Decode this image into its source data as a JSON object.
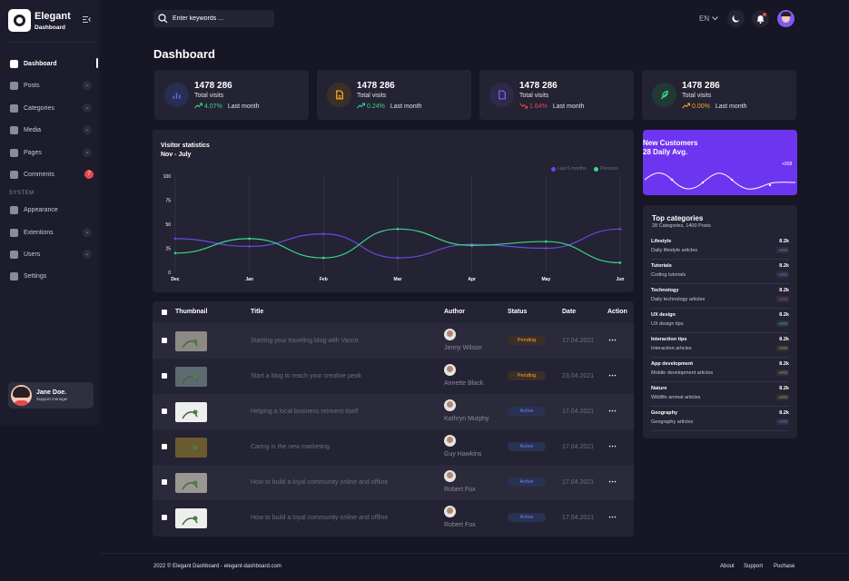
{
  "app": {
    "title": "Elegant",
    "subtitle": "Dashboard"
  },
  "sidebar": {
    "items": [
      {
        "label": "Dashboard",
        "icon": "home-icon",
        "active": true
      },
      {
        "label": "Posts",
        "icon": "posts-icon",
        "expandable": true
      },
      {
        "label": "Categories",
        "icon": "folder-icon",
        "expandable": true
      },
      {
        "label": "Media",
        "icon": "image-icon",
        "expandable": true
      },
      {
        "label": "Pages",
        "icon": "page-icon",
        "expandable": true
      },
      {
        "label": "Comments",
        "icon": "comment-icon",
        "badge": "7"
      }
    ],
    "system_label": "SYSTEM",
    "system_items": [
      {
        "label": "Appearance",
        "icon": "brush-icon"
      },
      {
        "label": "Extentions",
        "icon": "grid-icon",
        "expandable": true
      },
      {
        "label": "Users",
        "icon": "users-icon",
        "expandable": true
      },
      {
        "label": "Settings",
        "icon": "gear-icon"
      }
    ],
    "user": {
      "name": "Jane Doe.",
      "role": "Support manager"
    }
  },
  "header": {
    "search_placeholder": "Enter keywords ...",
    "language": "EN"
  },
  "page_title": "Dashboard",
  "stats": [
    {
      "value": "1478 286",
      "label": "Total visits",
      "change": "4.07%",
      "period": "Last month",
      "trend": "up",
      "trend_color": "#3cd68a",
      "icon": "chart-icon",
      "icon_color": "#5a6bf0",
      "icon_bg": "#2a2d52"
    },
    {
      "value": "1478 286",
      "label": "Total visits",
      "change": "0.24%",
      "period": "Last month",
      "trend": "up",
      "trend_color": "#3cd68a",
      "icon": "file-icon",
      "icon_color": "#f5a623",
      "icon_bg": "#3a3028"
    },
    {
      "value": "1478 286",
      "label": "Total visits",
      "change": "1.64%",
      "period": "Last month",
      "trend": "down",
      "trend_color": "#e5484d",
      "icon": "document-icon",
      "icon_color": "#7f5af0",
      "icon_bg": "#2e2a4a"
    },
    {
      "value": "1478 286",
      "label": "Total visits",
      "change": "0.00%",
      "period": "Last month",
      "trend": "up",
      "trend_color": "#f5a623",
      "icon": "feather-icon",
      "icon_color": "#3cd68a",
      "icon_bg": "#203a33"
    }
  ],
  "visitor_stats": {
    "title": "Visitor statistics",
    "subtitle": "Nov - July",
    "legend": [
      {
        "name": "Last 6 months",
        "color": "#6a48e0"
      },
      {
        "name": "Previous",
        "color": "#3cd68a"
      }
    ]
  },
  "chart_data": {
    "type": "line",
    "categories": [
      "Dec",
      "Jan",
      "Feb",
      "Mar",
      "Apr",
      "May",
      "Jun"
    ],
    "ylim": [
      0,
      100
    ],
    "yticks": [
      0,
      25,
      50,
      75,
      100
    ],
    "grid": "vertical",
    "legend_position": "top-right",
    "series": [
      {
        "name": "Last 6 months",
        "values": [
          35,
          27,
          40,
          15,
          29,
          25,
          45
        ]
      },
      {
        "name": "Previous",
        "values": [
          20,
          35,
          15,
          45,
          28,
          32,
          10
        ]
      }
    ]
  },
  "new_customers": {
    "title": "New Customers",
    "subtitle": "28 Daily Avg.",
    "peak": "+958"
  },
  "top_categories": {
    "title": "Top categories",
    "subtitle": "28 Categories, 1400 Posts",
    "items": [
      {
        "name": "Lifestyle",
        "desc": "Daily lifestyle articles",
        "value": "8.2k",
        "change": "+472",
        "color": "#5a8dee"
      },
      {
        "name": "Tutorials",
        "desc": "Coding tutorials",
        "value": "8.2k",
        "change": "+472",
        "color": "#5a8dee"
      },
      {
        "name": "Technology",
        "desc": "Daily technology articles",
        "value": "8.2k",
        "change": "+472",
        "color": "#e5484d"
      },
      {
        "name": "UX design",
        "desc": "UX design tips",
        "value": "8.2k",
        "change": "+472",
        "color": "#3cd68a"
      },
      {
        "name": "Interaction tips",
        "desc": "Interaction articles",
        "value": "8.2k",
        "change": "+472",
        "color": "#f5a623"
      },
      {
        "name": "App development",
        "desc": "Mobile development articles",
        "value": "8.2k",
        "change": "+472",
        "color": "#f5a623"
      },
      {
        "name": "Nature",
        "desc": "Wildlife animal articles",
        "value": "8.2k",
        "change": "+472",
        "color": "#f5a623"
      },
      {
        "name": "Geography",
        "desc": "Geography articles",
        "value": "8.2k",
        "change": "+472",
        "color": "#5a8dee"
      }
    ]
  },
  "table": {
    "headers": {
      "thumbnail": "Thumbnail",
      "title": "Title",
      "author": "Author",
      "status": "Status",
      "date": "Date",
      "action": "Action"
    },
    "rows": [
      {
        "title": "Starting your traveling blog with Vasco",
        "author": "Jenny Wilson",
        "status": "Pending",
        "date": "17.04.2021",
        "thumb": "#8d8a86"
      },
      {
        "title": "Start a blog to reach your creative peak",
        "author": "Annette Black",
        "status": "Pending",
        "date": "23.04.2021",
        "thumb": "#5e6a70"
      },
      {
        "title": "Helping a local business reinvent itself",
        "author": "Kathryn Murphy",
        "status": "Active",
        "date": "17.04.2021",
        "thumb": "#eeeeee"
      },
      {
        "title": "Caring is the new marketing",
        "author": "Guy Hawkins",
        "status": "Active",
        "date": "17.04.2021",
        "thumb": "#6b5a2e"
      },
      {
        "title": "How to build a loyal community online and offline",
        "author": "Robert Fox",
        "status": "Active",
        "date": "17.04.2021",
        "thumb": "#9a9692"
      },
      {
        "title": "How to build a loyal community online and offline",
        "author": "Robert Fox",
        "status": "Active",
        "date": "17.04.2021",
        "thumb": "#eeeeee"
      }
    ]
  },
  "footer": {
    "copyright": "2022 © Elegant Dashboard - elegant-dashboard.com",
    "links": [
      "About",
      "Support",
      "Puchase"
    ]
  }
}
